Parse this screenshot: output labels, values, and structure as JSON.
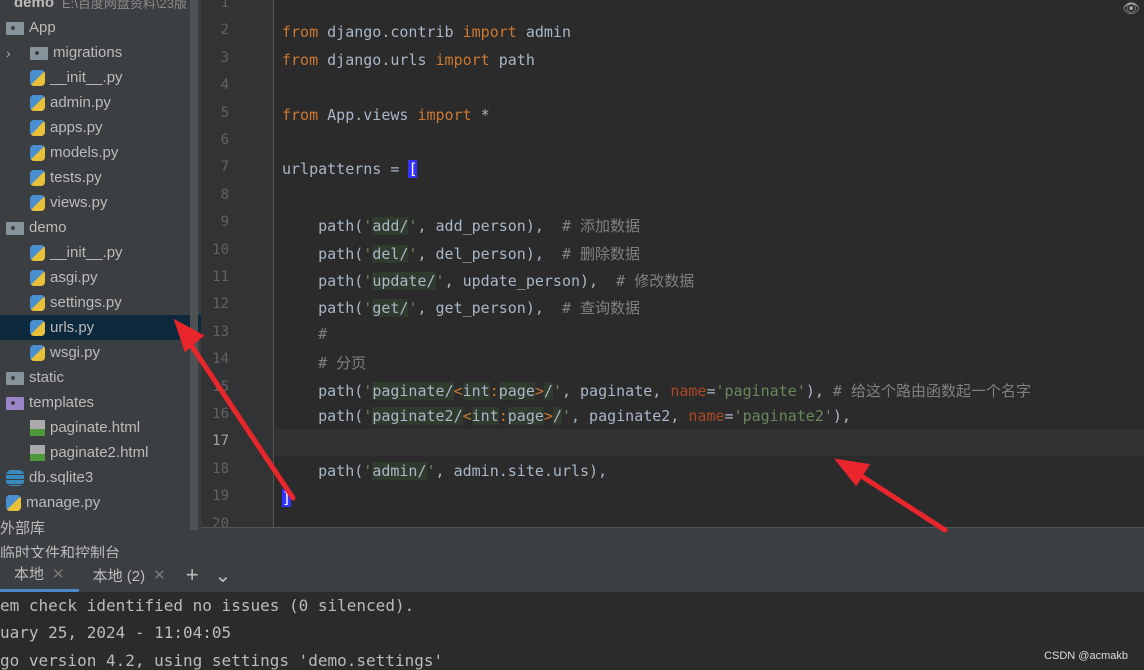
{
  "project_tree": [
    {
      "label": "demo",
      "path": "E:\\百度网盘资料\\23版",
      "type": "root",
      "indent": 0
    },
    {
      "label": "App",
      "type": "folder",
      "indent": 0
    },
    {
      "label": "migrations",
      "type": "folder",
      "indent": 1,
      "collapsed": true
    },
    {
      "label": "__init__.py",
      "type": "py",
      "indent": 1
    },
    {
      "label": "admin.py",
      "type": "py",
      "indent": 1
    },
    {
      "label": "apps.py",
      "type": "py",
      "indent": 1
    },
    {
      "label": "models.py",
      "type": "py",
      "indent": 1
    },
    {
      "label": "tests.py",
      "type": "py",
      "indent": 1
    },
    {
      "label": "views.py",
      "type": "py",
      "indent": 1
    },
    {
      "label": "demo",
      "type": "folder",
      "indent": 0
    },
    {
      "label": "__init__.py",
      "type": "py",
      "indent": 1
    },
    {
      "label": "asgi.py",
      "type": "py",
      "indent": 1
    },
    {
      "label": "settings.py",
      "type": "py",
      "indent": 1
    },
    {
      "label": "urls.py",
      "type": "py",
      "indent": 1,
      "selected": true
    },
    {
      "label": "wsgi.py",
      "type": "py",
      "indent": 1
    },
    {
      "label": "static",
      "type": "folder",
      "indent": 0
    },
    {
      "label": "templates",
      "type": "folder-purple",
      "indent": 0
    },
    {
      "label": "paginate.html",
      "type": "html",
      "indent": 1
    },
    {
      "label": "paginate2.html",
      "type": "html",
      "indent": 1
    },
    {
      "label": "db.sqlite3",
      "type": "db",
      "indent": 0
    },
    {
      "label": "manage.py",
      "type": "py",
      "indent": 0
    },
    {
      "label": "外部库",
      "type": "lib",
      "indent": -1
    },
    {
      "label": "临时文件和控制台",
      "type": "lib",
      "indent": -1
    }
  ],
  "editor": {
    "current_line": 17,
    "lines": [
      [],
      [
        [
          "from",
          "kw"
        ],
        [
          " django.contrib ",
          ""
        ],
        [
          "import",
          "kw"
        ],
        [
          " admin",
          ""
        ]
      ],
      [
        [
          "from",
          "kw"
        ],
        [
          " django.urls ",
          ""
        ],
        [
          "import",
          "kw"
        ],
        [
          " path",
          ""
        ]
      ],
      [],
      [
        [
          "from",
          "kw"
        ],
        [
          " App.views ",
          ""
        ],
        [
          "import",
          "kw"
        ],
        [
          " *",
          ""
        ]
      ],
      [],
      [
        [
          "urlpatterns = ",
          ""
        ],
        [
          "[",
          "br"
        ]
      ],
      [],
      [
        [
          "    path(",
          ""
        ],
        [
          "'",
          "str"
        ],
        [
          "add/",
          "strbg"
        ],
        [
          "'",
          "str"
        ],
        [
          ", add_person),  ",
          ""
        ],
        [
          "# 添加数据",
          "cm"
        ]
      ],
      [
        [
          "    path(",
          ""
        ],
        [
          "'",
          "str"
        ],
        [
          "del/",
          "strbg"
        ],
        [
          "'",
          "str"
        ],
        [
          ", del_person),  ",
          ""
        ],
        [
          "# 删除数据",
          "cm"
        ]
      ],
      [
        [
          "    path(",
          ""
        ],
        [
          "'",
          "str"
        ],
        [
          "update/",
          "strbg"
        ],
        [
          "'",
          "str"
        ],
        [
          ", update_person),  ",
          ""
        ],
        [
          "# 修改数据",
          "cm"
        ]
      ],
      [
        [
          "    path(",
          ""
        ],
        [
          "'",
          "str"
        ],
        [
          "get/",
          "strbg"
        ],
        [
          "'",
          "str"
        ],
        [
          ", get_person),  ",
          ""
        ],
        [
          "# 查询数据",
          "cm"
        ]
      ],
      [
        [
          "    #",
          "cm"
        ]
      ],
      [
        [
          "    # 分页",
          "cm"
        ]
      ],
      [
        [
          "    path(",
          ""
        ],
        [
          "'",
          "str"
        ],
        [
          "paginate/",
          "strbg"
        ],
        [
          "<",
          "kw"
        ],
        [
          "int",
          "strbg"
        ],
        [
          ":",
          "kw"
        ],
        [
          "page",
          "strbg"
        ],
        [
          ">",
          "kw"
        ],
        [
          "/",
          "strbg"
        ],
        [
          "'",
          "str"
        ],
        [
          ", paginate, ",
          ""
        ],
        [
          "name",
          "np"
        ],
        [
          "=",
          ""
        ],
        [
          "'paginate'",
          "str"
        ],
        [
          "), ",
          ""
        ],
        [
          "# 给这个路由函数起一个名字",
          "cm"
        ]
      ],
      [
        [
          "    path(",
          ""
        ],
        [
          "'",
          "str"
        ],
        [
          "paginate2/",
          "strbg"
        ],
        [
          "<",
          "kw"
        ],
        [
          "int",
          "strbg"
        ],
        [
          ":",
          "kw"
        ],
        [
          "page",
          "strbg"
        ],
        [
          ">",
          "kw"
        ],
        [
          "/",
          "strbg"
        ],
        [
          "'",
          "str"
        ],
        [
          ", paginate2, ",
          ""
        ],
        [
          "name",
          "np"
        ],
        [
          "=",
          ""
        ],
        [
          "'paginate2'",
          "str"
        ],
        [
          "),",
          ""
        ]
      ],
      [],
      [
        [
          "    path(",
          ""
        ],
        [
          "'",
          "str"
        ],
        [
          "admin/",
          "strbg"
        ],
        [
          "'",
          "str"
        ],
        [
          ", admin.site.urls),",
          ""
        ]
      ],
      [
        [
          "]",
          "br"
        ]
      ],
      []
    ]
  },
  "terminal": {
    "tabs": [
      {
        "label": "本地",
        "active": true
      },
      {
        "label": "本地 (2)",
        "active": false
      }
    ],
    "add_label": "+",
    "menu_label": "⌄",
    "lines": [
      "em check identified no issues (0 silenced).",
      "uary 25, 2024 - 11:04:05",
      "go version 4.2, using settings 'demo.settings'"
    ]
  },
  "watermark": "CSDN @acmakb",
  "annotation_color": "#e8262b"
}
